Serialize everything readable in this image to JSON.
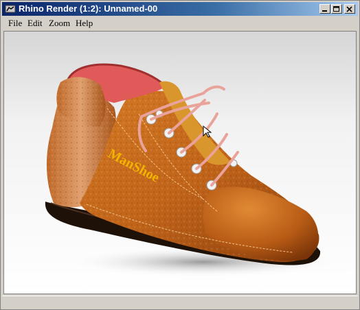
{
  "window": {
    "title": "Rhino Render (1:2): Unnamed-00",
    "app_icon": "rhino-app-icon"
  },
  "title_buttons": {
    "minimize": "minimize-icon",
    "maximize": "maximize-icon",
    "close": "close-icon"
  },
  "menu": {
    "items": [
      {
        "label": "File"
      },
      {
        "label": "Edit"
      },
      {
        "label": "Zoom"
      },
      {
        "label": "Help"
      }
    ]
  },
  "render": {
    "subject": "rendered leather shoe",
    "brand_text": "ManShoe",
    "colors": {
      "leather": "#c0641a",
      "leather_dark": "#7a3408",
      "lining": "#e05a5a",
      "lace": "#e9a39a",
      "eyelet": "#f2f2f2",
      "sole": "#1e1208",
      "brand": "#f2b400"
    }
  },
  "cursor": "arrow-cursor-icon"
}
